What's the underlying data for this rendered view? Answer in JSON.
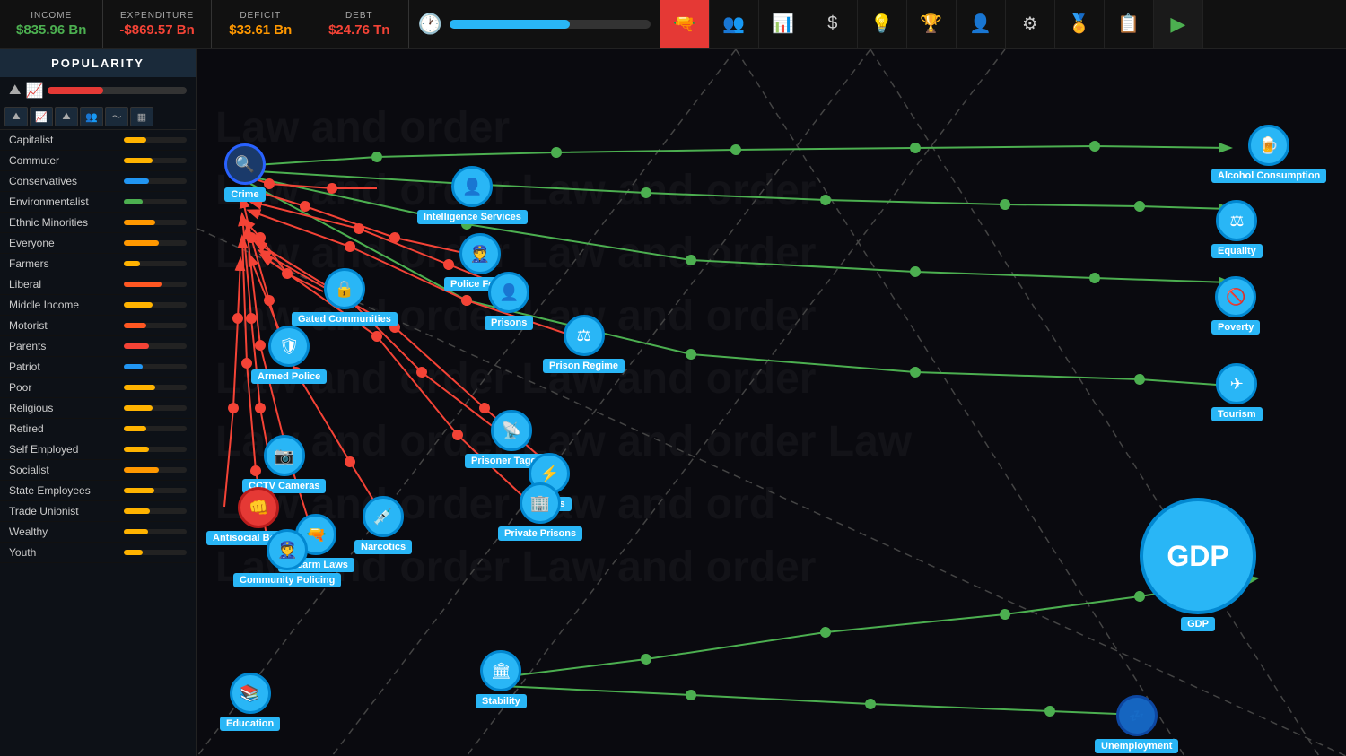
{
  "topbar": {
    "income_label": "INCOME",
    "income_value": "$835.96 Bn",
    "expenditure_label": "EXPENDITURE",
    "expenditure_value": "-$869.57 Bn",
    "deficit_label": "DEFICIT",
    "deficit_value": "$33.61 Bn",
    "debt_label": "DEBT",
    "debt_value": "$24.76 Tn"
  },
  "sidebar": {
    "popularity_label": "POPULARITY",
    "groups": [
      {
        "name": "Capitalist",
        "bar": 35,
        "color": "#ffb300"
      },
      {
        "name": "Commuter",
        "bar": 45,
        "color": "#ffb300"
      },
      {
        "name": "Conservatives",
        "bar": 40,
        "color": "#2196f3"
      },
      {
        "name": "Environmentalist",
        "bar": 30,
        "color": "#4caf50"
      },
      {
        "name": "Ethnic Minorities",
        "bar": 50,
        "color": "#ff9800"
      },
      {
        "name": "Everyone",
        "bar": 55,
        "color": "#ff9800"
      },
      {
        "name": "Farmers",
        "bar": 25,
        "color": "#ffb300"
      },
      {
        "name": "Liberal",
        "bar": 60,
        "color": "#ff5722"
      },
      {
        "name": "Middle Income",
        "bar": 45,
        "color": "#ffb300"
      },
      {
        "name": "Motorist",
        "bar": 35,
        "color": "#ff5722"
      },
      {
        "name": "Parents",
        "bar": 40,
        "color": "#f44336"
      },
      {
        "name": "Patriot",
        "bar": 30,
        "color": "#2196f3"
      },
      {
        "name": "Poor",
        "bar": 50,
        "color": "#ffb300"
      },
      {
        "name": "Religious",
        "bar": 45,
        "color": "#ffb300"
      },
      {
        "name": "Retired",
        "bar": 35,
        "color": "#ffb300"
      },
      {
        "name": "Self Employed",
        "bar": 40,
        "color": "#ffb300"
      },
      {
        "name": "Socialist",
        "bar": 55,
        "color": "#ff9800"
      },
      {
        "name": "State Employees",
        "bar": 48,
        "color": "#ffb300"
      },
      {
        "name": "Trade Unionist",
        "bar": 42,
        "color": "#ffb300"
      },
      {
        "name": "Wealthy",
        "bar": 38,
        "color": "#ffb300"
      },
      {
        "name": "Youth",
        "bar": 30,
        "color": "#ffb300"
      }
    ]
  },
  "nodes": {
    "crime": {
      "label": "Crime",
      "icon": "🔍"
    },
    "intelligence": {
      "label": "Intelligence Services",
      "icon": "👤"
    },
    "police_force": {
      "label": "Police Force",
      "icon": "👮"
    },
    "gated_communities": {
      "label": "Gated Communities",
      "icon": "🔒"
    },
    "armed_police": {
      "label": "Armed Police",
      "icon": "👮"
    },
    "prisons": {
      "label": "Prisons",
      "icon": "👤"
    },
    "prison_regime": {
      "label": "Prison Regime",
      "icon": "⚖"
    },
    "prisoner_tagging": {
      "label": "Prisoner Tagging",
      "icon": "📡"
    },
    "cctv": {
      "label": "CCTV Cameras",
      "icon": "📷"
    },
    "tasers": {
      "label": "Tasers",
      "icon": "🔫"
    },
    "private_prisons": {
      "label": "Private Prisons",
      "icon": "🏢"
    },
    "narcotics": {
      "label": "Narcotics",
      "icon": "💉"
    },
    "antisocial": {
      "label": "Antisocial Behavior",
      "icon": "👊"
    },
    "firearm_laws": {
      "label": "Firearm Laws",
      "icon": "🔫"
    },
    "community_policing": {
      "label": "Community Policing",
      "icon": "👮"
    },
    "education": {
      "label": "Education",
      "icon": "📚"
    },
    "stability": {
      "label": "Stability",
      "icon": "🏛"
    },
    "gdp": {
      "label": "GDP",
      "icon": "GDP"
    },
    "alcohol": {
      "label": "Alcohol Consumption",
      "icon": "🍺"
    },
    "equality": {
      "label": "Equality",
      "icon": "⚖"
    },
    "poverty": {
      "label": "Poverty",
      "icon": "🚫"
    },
    "tourism": {
      "label": "Tourism",
      "icon": "✈"
    },
    "unemployment": {
      "label": "Unemployment",
      "icon": "💤"
    }
  },
  "toolbar_icons": [
    "👥",
    "📊",
    "$",
    "💡",
    "🏆",
    "👤",
    "⚙",
    "🏅",
    "📋"
  ],
  "active_toolbar": 0
}
